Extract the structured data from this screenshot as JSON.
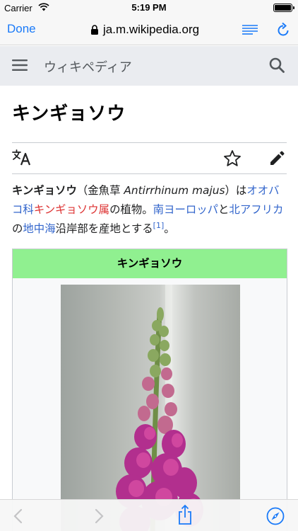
{
  "status_bar": {
    "carrier": "Carrier",
    "time": "5:19 PM"
  },
  "safari": {
    "done_label": "Done",
    "url": "ja.m.wikipedia.org"
  },
  "wiki_header": {
    "site_name": "ウィキペディア"
  },
  "article": {
    "heading": "キンギョソウ",
    "lead": {
      "term": "キンギョソウ",
      "open_paren": "（金魚草 ",
      "scientific_name": "Antirrhinum majus",
      "close_paren_ha": "）は",
      "link_family": "オオバコ科",
      "link_genus": "キンギョソウ属",
      "text_plant": "の植物。",
      "link_south_europe": "南ヨーロッパ",
      "text_and": "と",
      "link_north_africa": "北アフリカ",
      "text_no": "の",
      "link_mediterranean": "地中海",
      "text_origin": "沿岸部を産地とする",
      "footnote": "[1]",
      "period": "。"
    },
    "infobox": {
      "title": "キンギョソウ"
    }
  },
  "colors": {
    "link": "#3366cc",
    "redlink": "#d33333",
    "infobox_header": "#90f090",
    "ios_blue": "#1a7af8"
  }
}
